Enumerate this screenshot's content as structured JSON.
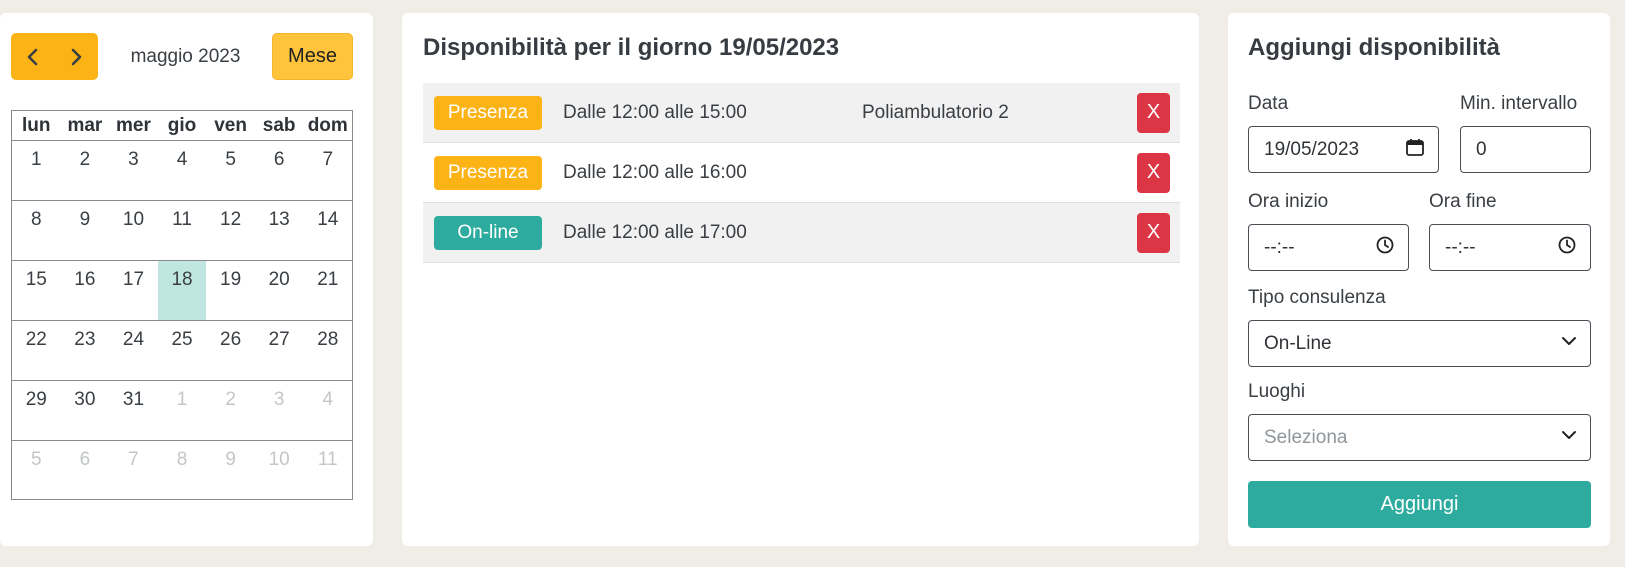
{
  "calendar": {
    "month_label": "maggio 2023",
    "view_label": "Mese",
    "weekdays": [
      "lun",
      "mar",
      "mer",
      "gio",
      "ven",
      "sab",
      "dom"
    ],
    "weeks": [
      [
        {
          "d": "1"
        },
        {
          "d": "2"
        },
        {
          "d": "3"
        },
        {
          "d": "4"
        },
        {
          "d": "5"
        },
        {
          "d": "6"
        },
        {
          "d": "7"
        }
      ],
      [
        {
          "d": "8"
        },
        {
          "d": "9"
        },
        {
          "d": "10"
        },
        {
          "d": "11"
        },
        {
          "d": "12"
        },
        {
          "d": "13"
        },
        {
          "d": "14"
        }
      ],
      [
        {
          "d": "15"
        },
        {
          "d": "16"
        },
        {
          "d": "17"
        },
        {
          "d": "18",
          "today": true
        },
        {
          "d": "19"
        },
        {
          "d": "20"
        },
        {
          "d": "21"
        }
      ],
      [
        {
          "d": "22"
        },
        {
          "d": "23"
        },
        {
          "d": "24"
        },
        {
          "d": "25"
        },
        {
          "d": "26"
        },
        {
          "d": "27"
        },
        {
          "d": "28"
        }
      ],
      [
        {
          "d": "29"
        },
        {
          "d": "30"
        },
        {
          "d": "31"
        },
        {
          "d": "1",
          "other": true
        },
        {
          "d": "2",
          "other": true
        },
        {
          "d": "3",
          "other": true
        },
        {
          "d": "4",
          "other": true
        }
      ],
      [
        {
          "d": "5",
          "other": true
        },
        {
          "d": "6",
          "other": true
        },
        {
          "d": "7",
          "other": true
        },
        {
          "d": "8",
          "other": true
        },
        {
          "d": "9",
          "other": true
        },
        {
          "d": "10",
          "other": true
        },
        {
          "d": "11",
          "other": true
        }
      ]
    ],
    "nav_icons": [
      "chevron-left-icon",
      "chevron-right-icon"
    ]
  },
  "availability": {
    "title": "Disponibilità per il giorno 19/05/2023",
    "delete_label": "X",
    "rows": [
      {
        "type": "Presenza",
        "type_color": "#fbb315",
        "time": "Dalle 12:00 alle 15:00",
        "place": "Poliambulatorio 2"
      },
      {
        "type": "Presenza",
        "type_color": "#fbb315",
        "time": "Dalle 12:00 alle 16:00",
        "place": ""
      },
      {
        "type": "On-line",
        "type_color": "#2dab9e",
        "time": "Dalle 12:00 alle 17:00",
        "place": ""
      }
    ]
  },
  "form": {
    "title": "Aggiungi disponibilità",
    "date_label": "Data",
    "date_value": "19/05/2023",
    "interval_label": "Min. intervallo",
    "interval_value": "0",
    "start_label": "Ora inizio",
    "start_value": "--:--",
    "end_label": "Ora fine",
    "end_value": "--:--",
    "type_label": "Tipo consulenza",
    "type_value": "On-Line",
    "places_label": "Luoghi",
    "places_placeholder": "Seleziona",
    "submit_label": "Aggiungi"
  },
  "colors": {
    "accent_yellow": "#fbb315",
    "accent_teal": "#2dab9e",
    "delete_red": "#dc3545",
    "today_bg": "#bfe6e0",
    "page_bg": "#efede6"
  }
}
